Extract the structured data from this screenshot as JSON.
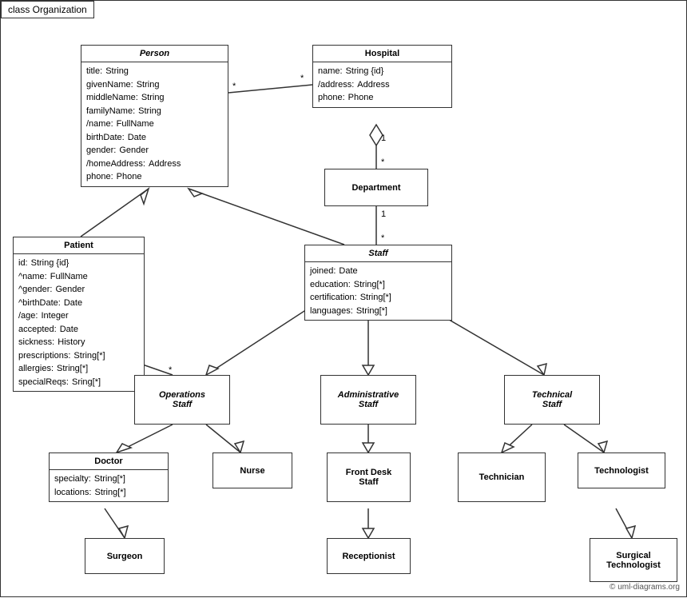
{
  "title": "class Organization",
  "copyright": "© uml-diagrams.org",
  "boxes": {
    "person": {
      "title": "Person",
      "attrs": [
        [
          "title:",
          "String"
        ],
        [
          "givenName:",
          "String"
        ],
        [
          "middleName:",
          "String"
        ],
        [
          "familyName:",
          "String"
        ],
        [
          "/name:",
          "FullName"
        ],
        [
          "birthDate:",
          "Date"
        ],
        [
          "gender:",
          "Gender"
        ],
        [
          "/homeAddress:",
          "Address"
        ],
        [
          "phone:",
          "Phone"
        ]
      ]
    },
    "hospital": {
      "title": "Hospital",
      "attrs": [
        [
          "name:",
          "String {id}"
        ],
        [
          "/address:",
          "Address"
        ],
        [
          "phone:",
          "Phone"
        ]
      ]
    },
    "patient": {
      "title": "Patient",
      "attrs": [
        [
          "id:",
          "String {id}"
        ],
        [
          "^name:",
          "FullName"
        ],
        [
          "^gender:",
          "Gender"
        ],
        [
          "^birthDate:",
          "Date"
        ],
        [
          "/age:",
          "Integer"
        ],
        [
          "accepted:",
          "Date"
        ],
        [
          "sickness:",
          "History"
        ],
        [
          "prescriptions:",
          "String[*]"
        ],
        [
          "allergies:",
          "String[*]"
        ],
        [
          "specialReqs:",
          "Sring[*]"
        ]
      ]
    },
    "department": {
      "title": "Department"
    },
    "staff": {
      "title": "Staff",
      "attrs": [
        [
          "joined:",
          "Date"
        ],
        [
          "education:",
          "String[*]"
        ],
        [
          "certification:",
          "String[*]"
        ],
        [
          "languages:",
          "String[*]"
        ]
      ]
    },
    "operations_staff": {
      "title": "Operations\nStaff",
      "italic": true
    },
    "administrative_staff": {
      "title": "Administrative\nStaff",
      "italic": true
    },
    "technical_staff": {
      "title": "Technical\nStaff",
      "italic": true
    },
    "doctor": {
      "title": "Doctor",
      "attrs": [
        [
          "specialty:",
          "String[*]"
        ],
        [
          "locations:",
          "String[*]"
        ]
      ]
    },
    "nurse": {
      "title": "Nurse"
    },
    "front_desk_staff": {
      "title": "Front Desk\nStaff"
    },
    "technician": {
      "title": "Technician"
    },
    "technologist": {
      "title": "Technologist"
    },
    "surgeon": {
      "title": "Surgeon"
    },
    "receptionist": {
      "title": "Receptionist"
    },
    "surgical_technologist": {
      "title": "Surgical\nTechnologist"
    }
  },
  "multiplicity": {
    "star": "*",
    "one": "1"
  }
}
